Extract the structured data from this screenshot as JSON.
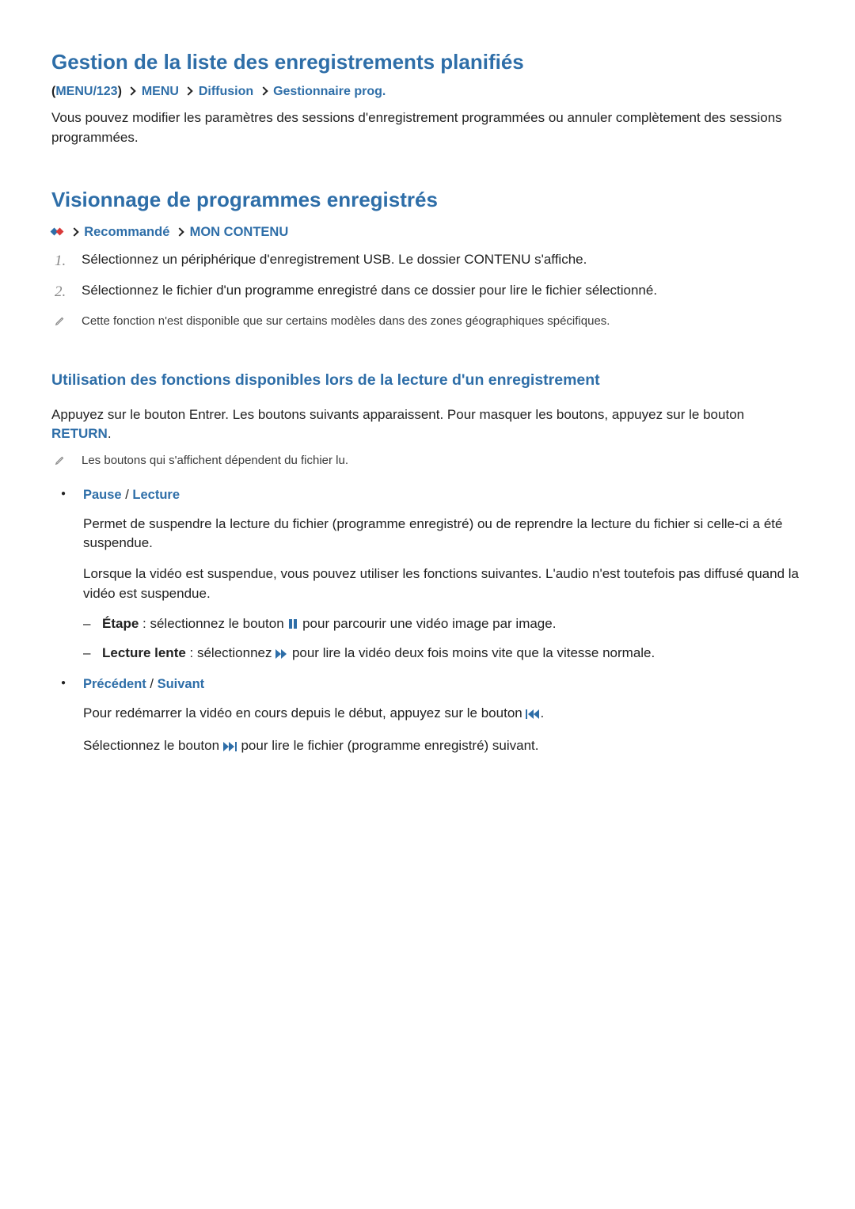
{
  "s1": {
    "title": "Gestion de la liste des enregistrements planifiés",
    "crumb": {
      "a": "MENU/123",
      "b": "MENU",
      "c": "Diffusion",
      "d": "Gestionnaire prog."
    },
    "body": "Vous pouvez modifier les paramètres des sessions d'enregistrement programmées ou annuler complètement des sessions programmées."
  },
  "s2": {
    "title": "Visionnage de programmes enregistrés",
    "crumb": {
      "a": "Recommandé",
      "b": "MON CONTENU"
    },
    "steps": {
      "n1": "1.",
      "t1": "Sélectionnez un périphérique d'enregistrement USB. Le dossier CONTENU s'affiche.",
      "n2": "2.",
      "t2": "Sélectionnez le fichier d'un programme enregistré dans ce dossier pour lire le fichier sélectionné."
    },
    "note1": "Cette fonction n'est disponible que sur certains modèles dans des zones géographiques spécifiques."
  },
  "s3": {
    "title": "Utilisation des fonctions disponibles lors de la lecture d'un enregistrement",
    "intro_a": "Appuyez sur le bouton Entrer. Les boutons suivants apparaissent. Pour masquer les boutons, appuyez sur le bouton ",
    "intro_kw": "RETURN",
    "intro_b": ".",
    "note": "Les boutons qui s'affichent dépendent du fichier lu.",
    "b1": {
      "h1": "Pause",
      "h2": "Lecture",
      "p1": "Permet de suspendre la lecture du fichier (programme enregistré) ou de reprendre la lecture du fichier si celle-ci a été suspendue.",
      "p2": "Lorsque la vidéo est suspendue, vous pouvez utiliser les fonctions suivantes. L'audio n'est toutefois pas diffusé quand la vidéo est suspendue.",
      "d1a": "Étape",
      "d1b": " : sélectionnez le bouton ",
      "d1c": " pour parcourir une vidéo image par image.",
      "d2a": "Lecture lente",
      "d2b": " : sélectionnez ",
      "d2c": " pour lire la vidéo deux fois moins vite que la vitesse normale."
    },
    "b2": {
      "h1": "Précédent",
      "h2": "Suivant",
      "p1a": "Pour redémarrer la vidéo en cours depuis le début, appuyez sur le bouton ",
      "p1b": ".",
      "p2a": "Sélectionnez le bouton ",
      "p2b": " pour lire le fichier (programme enregistré) suivant."
    }
  }
}
